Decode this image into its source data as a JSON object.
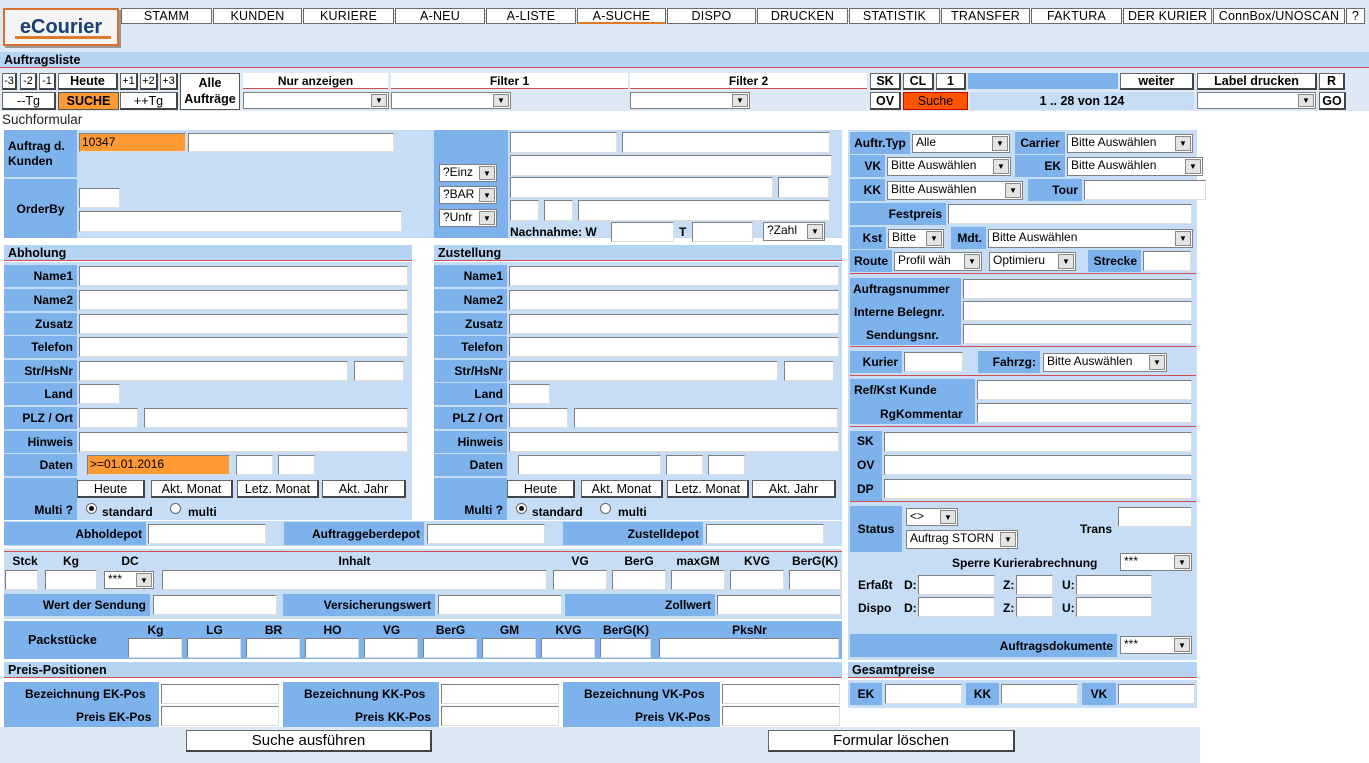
{
  "logo": {
    "text": "eCourier"
  },
  "nav": [
    "STAMM",
    "KUNDEN",
    "KURIERE",
    "A-NEU",
    "A-LISTE",
    "A-SUCHE",
    "DISPO",
    "DRUCKEN",
    "STATISTIK",
    "TRANSFER",
    "FAKTURA",
    "DER KURIER",
    "ConnBox/UNOSCAN",
    "?"
  ],
  "nav_active": "A-SUCHE",
  "list_title": "Auftragsliste",
  "toolbar": {
    "days": [
      "-3",
      "-2",
      "-1"
    ],
    "today": "Heute",
    "plus_days": [
      "+1",
      "+2",
      "+3"
    ],
    "prev_day": "--Tg",
    "search": "SUCHE",
    "next_day": "++Tg",
    "all_orders_1": "Alle",
    "all_orders_2": "Aufträge",
    "only_show": "Nur anzeigen",
    "filter1": "Filter 1",
    "filter2": "Filter 2",
    "sk": "SK",
    "cl": "CL",
    "num": "1",
    "ov": "OV",
    "suche": "Suche",
    "next": "weiter",
    "range": "1 .. 28 von 124",
    "print_label": "Label drucken",
    "r": "R",
    "go": "GO"
  },
  "form_title": "Suchformular",
  "order": {
    "customer_order_label": "Auftrag d. Kunden",
    "customer_order_value": "10347",
    "orderby_label": "OrderBy",
    "sel_einz": "?Einz",
    "sel_bar": "?BAR",
    "sel_unfr": "?Unfr",
    "cod_label": "Nachnahme: W",
    "cod_t": "T",
    "sel_zahl": "?Zahl"
  },
  "pickup": {
    "title": "Abholung",
    "fields": [
      "Name1",
      "Name2",
      "Zusatz",
      "Telefon",
      "Str/HsNr",
      "Land",
      "PLZ / Ort",
      "Hinweis",
      "Daten"
    ],
    "date_value": ">=01.01.2016",
    "btns": [
      "Heute",
      "Akt. Monat",
      "Letz. Monat",
      "Akt. Jahr"
    ],
    "multi_label": "Multi ?",
    "standard": "standard",
    "multi": "multi"
  },
  "delivery": {
    "title": "Zustellung",
    "fields": [
      "Name1",
      "Name2",
      "Zusatz",
      "Telefon",
      "Str/HsNr",
      "Land",
      "PLZ / Ort",
      "Hinweis",
      "Daten"
    ],
    "btns": [
      "Heute",
      "Akt. Monat",
      "Letz. Monat",
      "Akt. Jahr"
    ],
    "multi_label": "Multi ?",
    "standard": "standard",
    "multi": "multi"
  },
  "depots": {
    "pickup": "Abholdepot",
    "client": "Auftraggeberdepot",
    "delivery": "Zustelldepot"
  },
  "goods": {
    "headers": [
      "Stck",
      "Kg",
      "DC",
      "Inhalt",
      "VG",
      "BerG",
      "maxGM",
      "KVG",
      "BerG(K)"
    ],
    "dc_value": "***",
    "value_label": "Wert der Sendung",
    "insurance_label": "Versicherungswert",
    "customs_label": "Zollwert"
  },
  "packages": {
    "label": "Packstücke",
    "headers": [
      "Kg",
      "LG",
      "BR",
      "HO",
      "VG",
      "BerG",
      "GM",
      "KVG",
      "BerG(K)",
      "PksNr"
    ]
  },
  "prices": {
    "title": "Preis-Positionen",
    "ek_name": "Bezeichnung EK-Pos",
    "ek_price": "Preis EK-Pos",
    "kk_name": "Bezeichnung KK-Pos",
    "kk_price": "Preis KK-Pos",
    "vk_name": "Bezeichnung VK-Pos",
    "vk_price": "Preis VK-Pos"
  },
  "actions": {
    "search": "Suche ausführen",
    "clear": "Formular löschen"
  },
  "right": {
    "type_label": "Auftr.Typ",
    "type_value": "Alle",
    "carrier_label": "Carrier",
    "carrier_value": "Bitte Auswählen",
    "vk_label": "VK",
    "vk_value": "Bitte Auswählen",
    "ek_label": "EK",
    "ek_value": "Bitte Auswählen",
    "kk_label": "KK",
    "kk_value": "Bitte Auswählen",
    "tour_label": "Tour",
    "fixed_label": "Festpreis",
    "kst_label": "Kst",
    "kst_value": "Bitte",
    "mdt_label": "Mdt.",
    "mdt_value": "Bitte Auswählen",
    "route_label": "Route",
    "route_value": "Profil wäh",
    "opt_value": "Optimieru",
    "distance_label": "Strecke",
    "ordernum_label": "Auftragsnummer",
    "internal_label": "Interne Belegnr.",
    "shipment_label": "Sendungsnr.",
    "courier_label": "Kurier",
    "vehicle_label": "Fahrzg:",
    "vehicle_value": "Bitte Auswählen",
    "ref_label": "Ref/Kst Kunde",
    "rg_label": "RgKommentar",
    "sk": "SK",
    "ov": "OV",
    "dp": "DP",
    "status_label": "Status",
    "status_op": "<>",
    "status_value": "Auftrag STORN",
    "trans_label": "Trans",
    "lock_label": "Sperre Kurierabrechnung",
    "lock_value": "***",
    "captured_label": "Erfaßt",
    "dispo_label": "Dispo",
    "d": "D:",
    "z": "Z:",
    "u": "U:",
    "docs_label": "Auftragsdokumente",
    "docs_value": "***",
    "totals_title": "Gesamtpreise",
    "ek": "EK",
    "kk": "KK",
    "vk": "VK"
  },
  "icons": {
    "dropdown": "chevron-down-icon"
  }
}
